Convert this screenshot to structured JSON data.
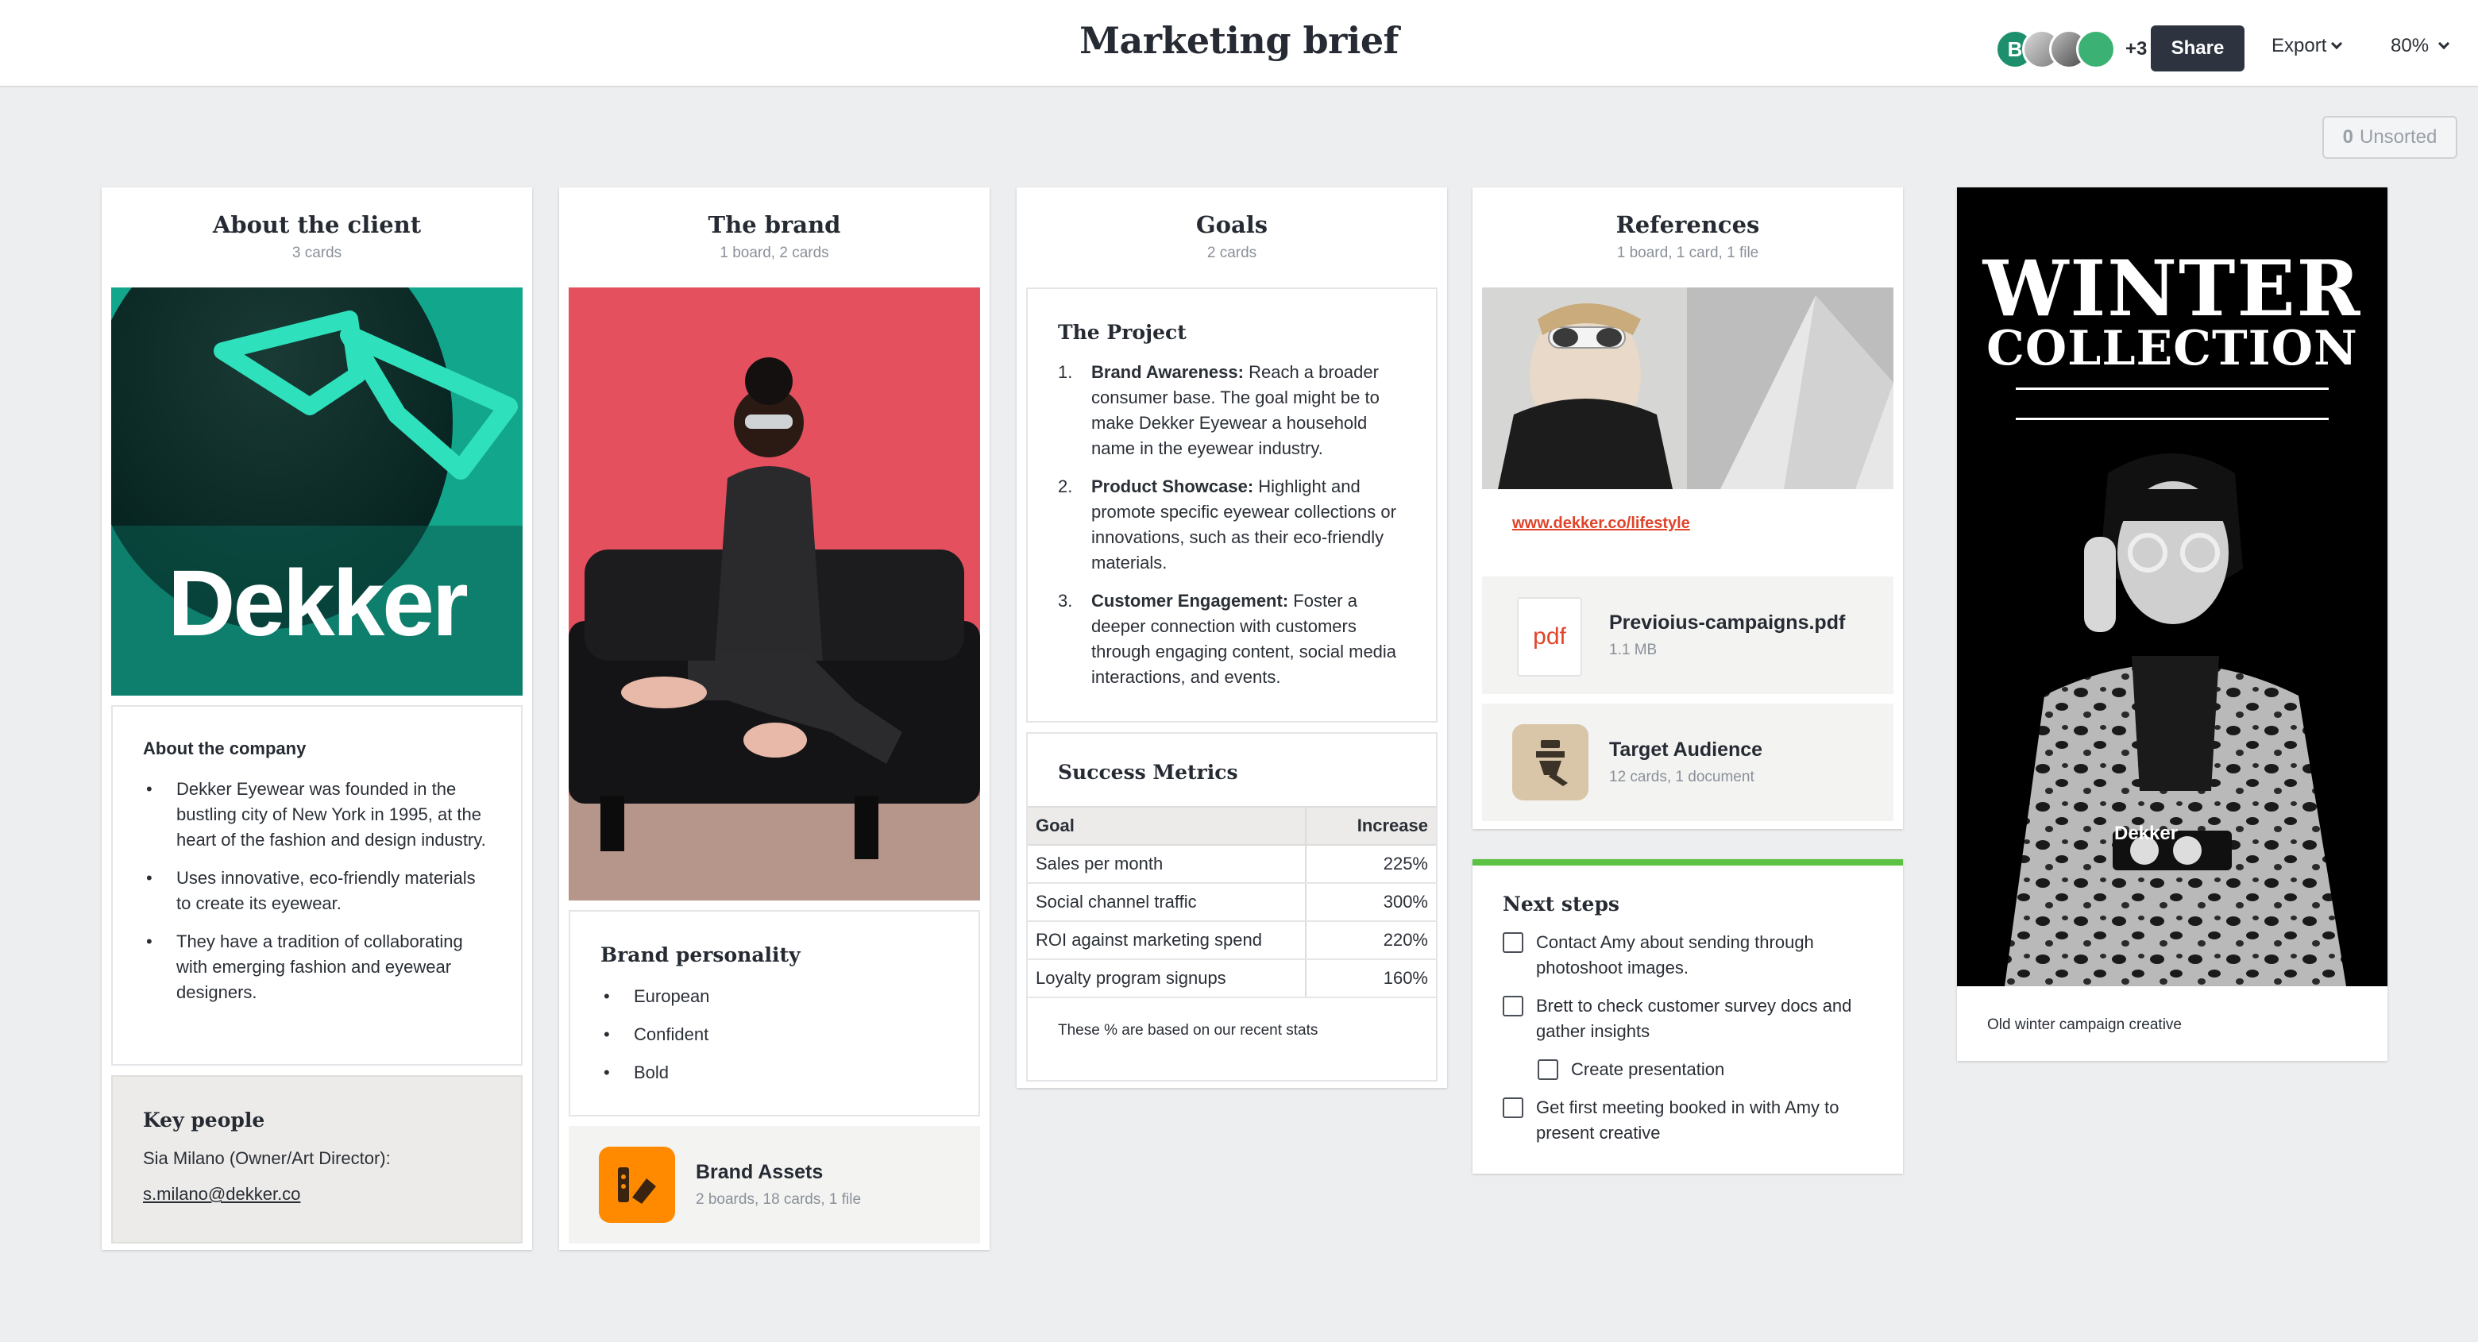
{
  "header": {
    "title": "Marketing brief",
    "avatar_initial": "B",
    "extra_collaborators": "+3",
    "share_label": "Share",
    "export_label": "Export",
    "zoom": "80%"
  },
  "unsorted": {
    "count": "0",
    "label": "Unsorted"
  },
  "columns": {
    "client": {
      "title": "About the client",
      "subtitle": "3 cards",
      "logo_text": "Dekker",
      "about": {
        "heading": "About the company",
        "bullets": [
          "Dekker Eyewear was founded in the bustling city of New York in 1995, at the heart of the fashion and design industry.",
          "Uses innovative, eco-friendly materials to create its eyewear.",
          "They have a tradition of collaborating with emerging fashion and eyewear designers."
        ]
      },
      "key_people": {
        "heading": "Key people",
        "person": "Sia Milano (Owner/Art Director):",
        "email": "s.milano@dekker.co"
      }
    },
    "brand": {
      "title": "The brand",
      "subtitle": "1 board, 2 cards",
      "personality": {
        "heading": "Brand personality",
        "items": [
          "European",
          "Confident",
          "Bold"
        ]
      },
      "assets": {
        "title": "Brand Assets",
        "subtitle": "2 boards, 18 cards, 1 file"
      }
    },
    "goals": {
      "title": "Goals",
      "subtitle": "2 cards",
      "project": {
        "heading": "The Project",
        "items": [
          {
            "num": "1.",
            "bold": "Brand Awareness:",
            "text": " Reach a broader consumer base. The goal might be to make Dekker Eyewear a household name in the eyewear industry."
          },
          {
            "num": "2.",
            "bold": "Product Showcase:",
            "text": " Highlight and promote specific eyewear collections or innovations, such as their eco-friendly materials."
          },
          {
            "num": "3.",
            "bold": "Customer Engagement:",
            "text": " Foster a deeper connection with customers through engaging content, social media interactions, and events."
          }
        ]
      },
      "metrics": {
        "heading": "Success Metrics",
        "col_goal": "Goal",
        "col_increase": "Increase",
        "rows": [
          {
            "goal": "Sales per month",
            "increase": "225%"
          },
          {
            "goal": "Social channel traffic",
            "increase": "300%"
          },
          {
            "goal": "ROI against marketing spend",
            "increase": "220%"
          },
          {
            "goal": "Loyalty program signups",
            "increase": "160%"
          }
        ],
        "note": "These % are based on our recent stats"
      }
    },
    "references": {
      "title": "References",
      "subtitle": "1 board, 1 card, 1 file",
      "link": "www.dekker.co/lifestyle",
      "pdf": {
        "icon_label": "pdf",
        "title": "Previoius-campaigns.pdf",
        "size": "1.1 MB"
      },
      "audience": {
        "title": "Target Audience",
        "subtitle": "12 cards, 1 document"
      }
    },
    "next_steps": {
      "heading": "Next steps",
      "tasks": [
        "Contact Amy about sending through photoshoot images.",
        "Brett to check customer survey docs and gather insights",
        "Create presentation",
        "Get first meeting booked in with Amy to present creative"
      ]
    },
    "winter": {
      "line1": "WINTER",
      "line2": "COLLECTION",
      "scarf_text": "Dekker",
      "caption": "Old winter campaign creative"
    }
  },
  "colors": {
    "accent_dark": "#2d3440",
    "link_red": "#e0442b",
    "teal": "#17a88e",
    "next_steps_bar": "#5cc244",
    "asset_orange": "#ff8a00"
  }
}
